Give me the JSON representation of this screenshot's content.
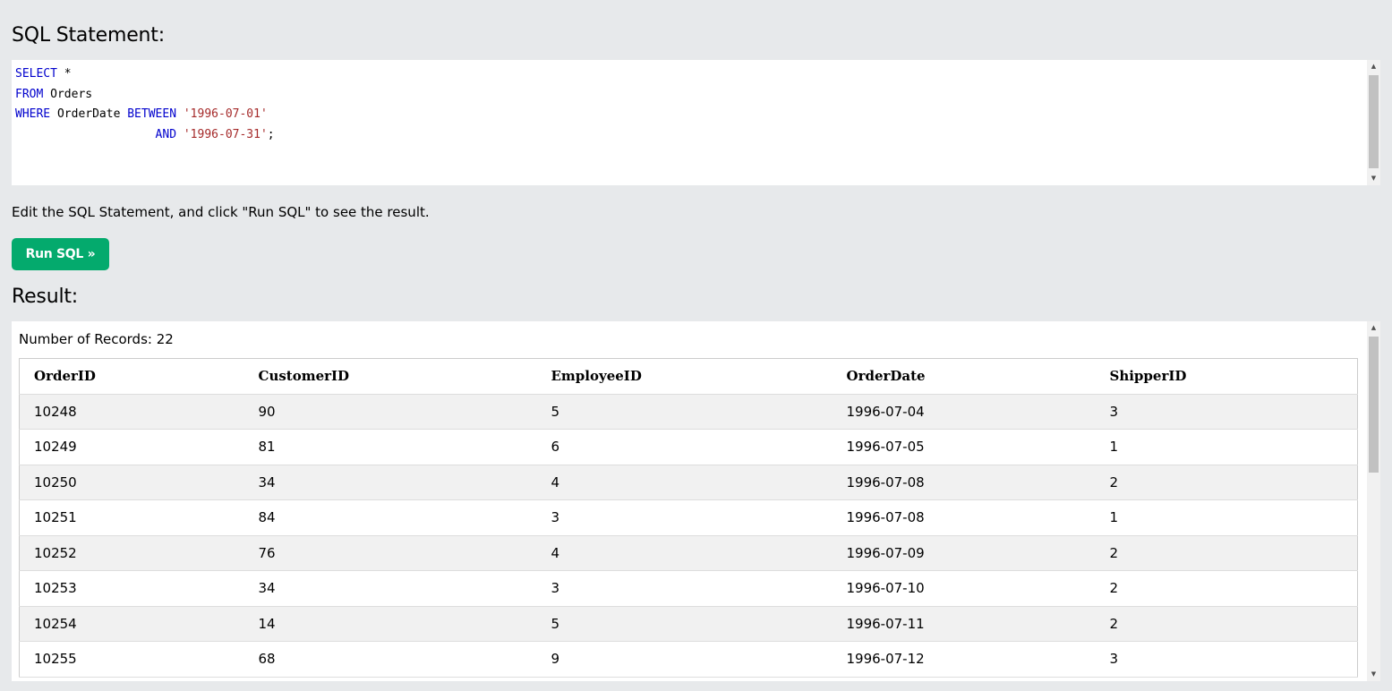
{
  "sql_section": {
    "heading": "SQL Statement:",
    "lines": [
      [
        {
          "t": "SELECT",
          "k": "kw"
        },
        {
          "t": " *",
          "k": ""
        }
      ],
      [
        {
          "t": "FROM",
          "k": "kw"
        },
        {
          "t": " Orders",
          "k": ""
        }
      ],
      [
        {
          "t": "WHERE",
          "k": "kw"
        },
        {
          "t": " OrderDate ",
          "k": ""
        },
        {
          "t": "BETWEEN",
          "k": "kw"
        },
        {
          "t": " ",
          "k": ""
        },
        {
          "t": "'1996-07-01'",
          "k": "str"
        }
      ],
      [
        {
          "t": "                    ",
          "k": ""
        },
        {
          "t": "AND",
          "k": "kw"
        },
        {
          "t": " ",
          "k": ""
        },
        {
          "t": "'1996-07-31'",
          "k": "str"
        },
        {
          "t": ";",
          "k": ""
        }
      ]
    ]
  },
  "hint_text": "Edit the SQL Statement, and click \"Run SQL\" to see the result.",
  "run_button_label": "Run SQL »",
  "result_section": {
    "heading": "Result:",
    "record_count": "Number of Records: 22",
    "columns": [
      "OrderID",
      "CustomerID",
      "EmployeeID",
      "OrderDate",
      "ShipperID"
    ],
    "rows": [
      [
        "10248",
        "90",
        "5",
        "1996-07-04",
        "3"
      ],
      [
        "10249",
        "81",
        "6",
        "1996-07-05",
        "1"
      ],
      [
        "10250",
        "34",
        "4",
        "1996-07-08",
        "2"
      ],
      [
        "10251",
        "84",
        "3",
        "1996-07-08",
        "1"
      ],
      [
        "10252",
        "76",
        "4",
        "1996-07-09",
        "2"
      ],
      [
        "10253",
        "34",
        "3",
        "1996-07-10",
        "2"
      ],
      [
        "10254",
        "14",
        "5",
        "1996-07-11",
        "2"
      ],
      [
        "10255",
        "68",
        "9",
        "1996-07-12",
        "3"
      ]
    ]
  },
  "colors": {
    "background": "#e7e9eb",
    "button": "#04aa6d",
    "keyword": "#0000cd",
    "string": "#a52a2a",
    "striped_row": "#f1f1f1"
  }
}
